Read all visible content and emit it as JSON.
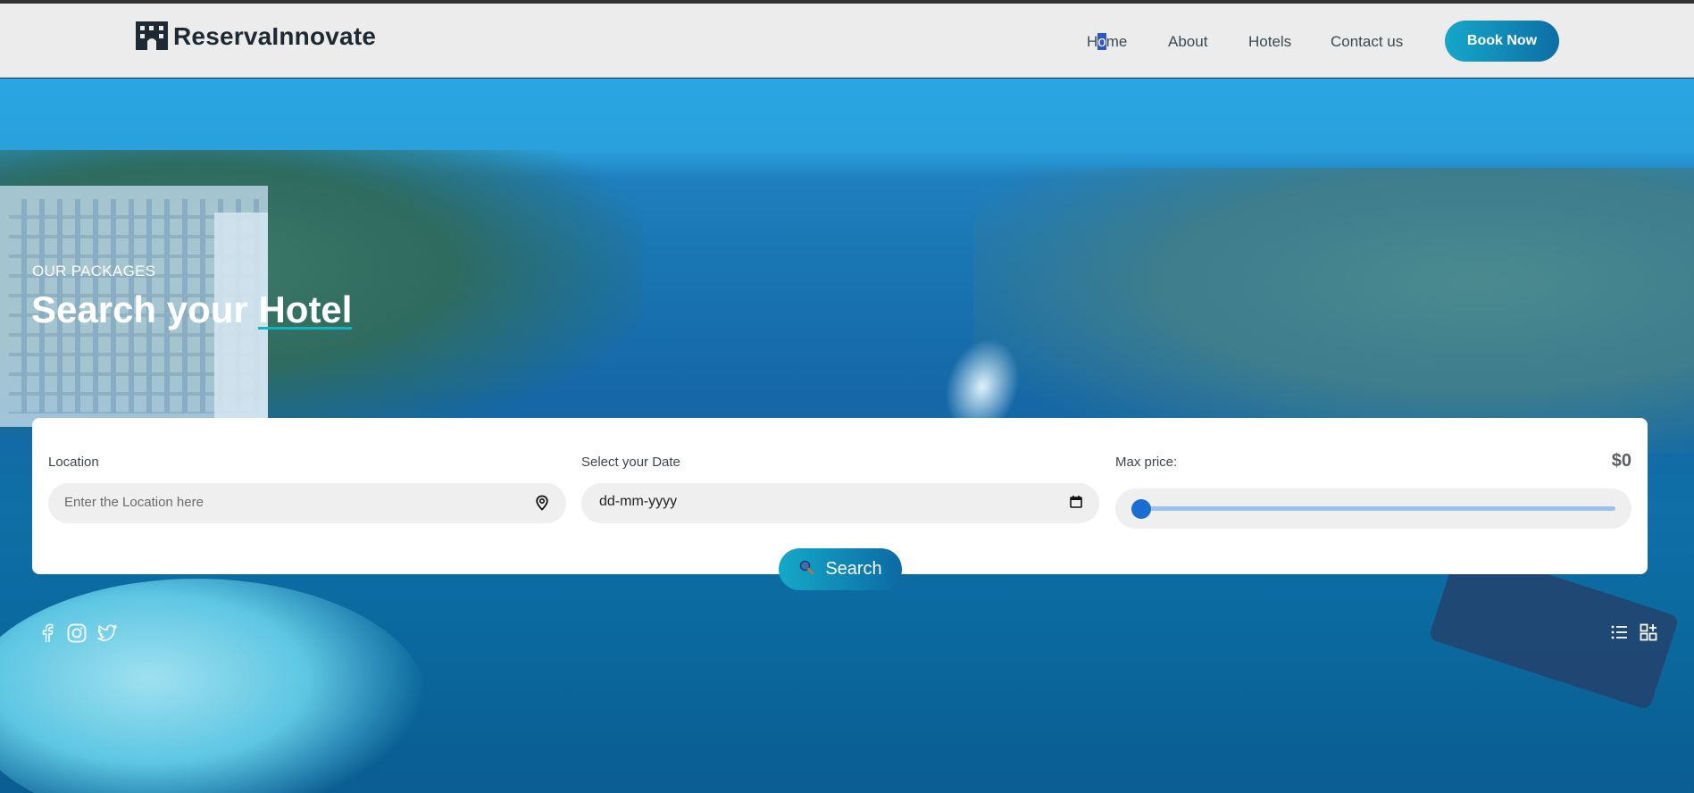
{
  "header": {
    "logo_text": "ReservaInnovate",
    "logo_icon": "hotel-building-icon",
    "nav": {
      "home_pre": "H",
      "home_sel": "o",
      "home_post": "me",
      "about": "About",
      "hotels": "Hotels",
      "contact": "Contact us"
    },
    "book_now": "Book Now"
  },
  "hero": {
    "eyebrow": "OUR PACKAGES",
    "title_main": "Search your ",
    "title_accent": "Hotel"
  },
  "search_form": {
    "location_label": "Location",
    "location_placeholder": "Enter the Location here",
    "date_label": "Select your Date",
    "date_value": "dd-mm-yyyy",
    "price_label": "Max price:",
    "price_value": "$0",
    "slider_fraction": 0,
    "search_label": "Search"
  },
  "icons": {
    "location": "map-pin-icon",
    "calendar": "calendar-icon",
    "search": "magnifier-icon",
    "facebook": "facebook-icon",
    "instagram": "instagram-icon",
    "twitter": "twitter-icon",
    "list_view": "list-view-icon",
    "grid_view": "grid-add-icon"
  },
  "colors": {
    "accent": "#14a9c8",
    "accent_dark": "#0c6aa3",
    "slider_thumb": "#1b6ed1",
    "nav_text": "#3b4a55"
  }
}
